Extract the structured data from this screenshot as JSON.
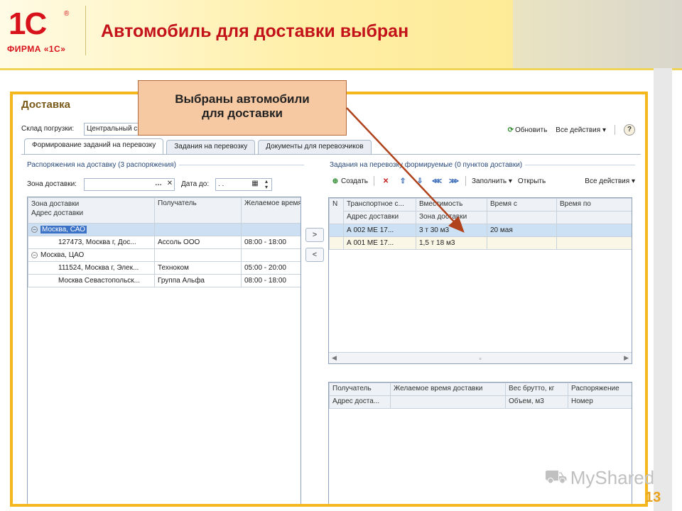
{
  "slide": {
    "logo_mark": "1С",
    "logo_reg": "®",
    "logo_firm": "ФИРМА «1С»",
    "title": "Автомобиль для доставки выбран",
    "page_number": "13",
    "watermark": "MyShared"
  },
  "callout": {
    "line1": "Выбраны автомобили",
    "line2": "для доставки"
  },
  "window": {
    "title": "Доставка",
    "warehouse_label": "Склад погрузки:",
    "warehouse_value": "Центральный склад ТД",
    "refresh_label": "Обновить",
    "all_actions_label": "Все действия",
    "help_label": "?"
  },
  "tabs": [
    {
      "label": "Формирование заданий на перевозку"
    },
    {
      "label": "Задания на перевозку"
    },
    {
      "label": "Документы для перевозчиков"
    }
  ],
  "left": {
    "section_title": "Распоряжения на доставку (3 распоряжения)",
    "zone_label": "Зона доставки:",
    "zone_value": "",
    "date_label": "Дата до:",
    "date_value": ". .",
    "columns": {
      "zone_top": "Зона доставки",
      "zone_bottom": "Адрес доставки",
      "recipient": "Получатель",
      "time": "Желаемое время"
    },
    "groups": [
      {
        "zone": "Москва, САО",
        "rows": [
          {
            "address": "127473, Москва г, Дос...",
            "recipient": "Ассоль ООО",
            "time": "08:00 - 18:00"
          }
        ]
      },
      {
        "zone": "Москва, ЦАО",
        "rows": [
          {
            "address": "111524, Москва г, Элек...",
            "recipient": "Техноком",
            "time": "05:00 - 20:00"
          },
          {
            "address": "Москва Севастопольск...",
            "recipient": "Группа Альфа",
            "time": "08:00 - 18:00"
          }
        ]
      }
    ]
  },
  "move": {
    "right": ">",
    "left": "<"
  },
  "right": {
    "section_title": "Задания на перевозку формируемые (0 пунктов доставки)",
    "toolbar": {
      "create": "Создать",
      "fill": "Заполнить",
      "open": "Открыть",
      "all_actions": "Все действия"
    },
    "columns": {
      "n": "N",
      "transport": "Транспортное с...",
      "capacity": "Вместимость",
      "time_from": "Время с",
      "time_to": "Время по",
      "address": "Адрес доставки",
      "zone": "Зона доставки"
    },
    "rows": [
      {
        "transport": "А 002 МЕ 17...",
        "capacity": "3 т 30 м3",
        "time_from": "20 мая",
        "time_to": ""
      },
      {
        "transport": "А 001 МЕ 17...",
        "capacity": "1,5 т 18 м3",
        "time_from": "",
        "time_to": ""
      }
    ],
    "lower_columns": {
      "recipient": "Получатель",
      "time": "Желаемое время доставки",
      "weight": "Вес брутто, кг",
      "order": "Распоряжение",
      "address": "Адрес доста...",
      "volume": "Объем, м3",
      "number": "Номер"
    }
  }
}
